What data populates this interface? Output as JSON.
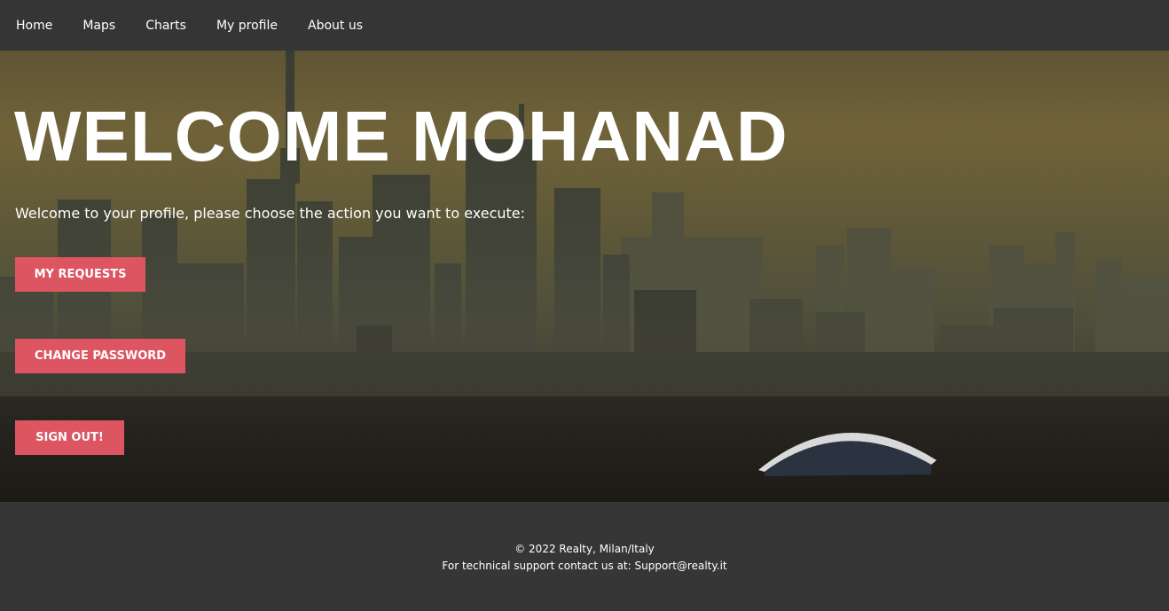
{
  "nav": {
    "items": [
      {
        "label": "Home"
      },
      {
        "label": "Maps"
      },
      {
        "label": "Charts"
      },
      {
        "label": "My profile"
      },
      {
        "label": "About us"
      }
    ]
  },
  "hero": {
    "title": "WELCOME MOHANAD",
    "subtitle": "Welcome to your profile, please choose the action you want to execute:",
    "background": "city-skyline-image",
    "buttons": {
      "requests": "MY REQUESTS",
      "password": "CHANGE PASSWORD",
      "signout": "SIGN OUT!"
    },
    "button_color": "#dc5561"
  },
  "footer": {
    "copyright": "© 2022 Realty, Milan/Italy",
    "support": "For technical support contact us at: Support@realty.it"
  },
  "colors": {
    "navbar": "#353535",
    "footer": "#363636",
    "accent": "#dc5561"
  }
}
